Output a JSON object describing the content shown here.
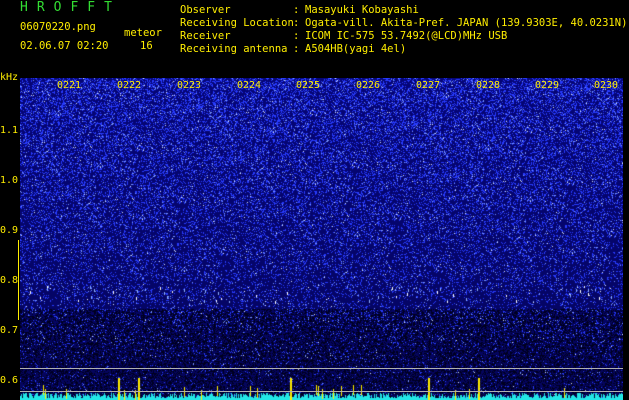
{
  "header": {
    "app_title": "HROFFT",
    "filename": "06070220.png",
    "date": "02.06.07 02:20",
    "meteor_label": "meteor",
    "meteor_count": "16"
  },
  "info": [
    {
      "label": "Observer",
      "value": "Masayuki Kobayashi"
    },
    {
      "label": "Receiving Location",
      "value": "Ogata-vill. Akita-Pref. JAPAN (139.9303E, 40.0231N)"
    },
    {
      "label": "Receiver",
      "value": "ICOM IC-575 53.7492(@LCD)MHz USB"
    },
    {
      "label": "Receiving antenna",
      "value": "A504HB(yagi 4el)"
    }
  ],
  "colors": {
    "background": "#000000",
    "plot_background": "#05056e",
    "title_green": "#33dd33",
    "label_yellow": "#ffee00",
    "noise_blue": "#3a4dff",
    "baseline_cyan": "#22e6e6"
  },
  "y_axis": {
    "unit": "kHz",
    "ticks": [
      "1.1",
      "1.0",
      "0.9",
      "0.8",
      "0.7",
      "0.6"
    ]
  },
  "x_axis": {
    "ticks": [
      "0221",
      "0222",
      "0223",
      "0224",
      "0225",
      "0226",
      "0227",
      "0228",
      "0229",
      "0230"
    ]
  }
}
